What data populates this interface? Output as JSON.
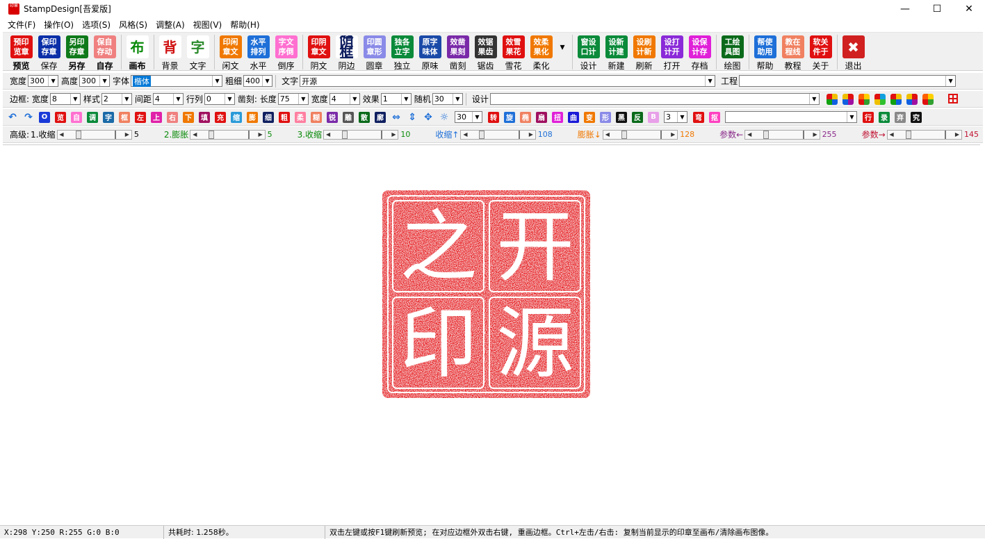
{
  "title": {
    "app_icon": "印章",
    "text": "StampDesign[吾爱版]",
    "min": "—",
    "max": "☐",
    "close": "✕"
  },
  "menu": [
    "文件(F)",
    "操作(O)",
    "选项(S)",
    "风格(S)",
    "调整(A)",
    "视图(V)",
    "帮助(H)"
  ],
  "toolbar": [
    {
      "icon": "预印\n览章",
      "label": "预览",
      "color": "#e01010",
      "bold": true
    },
    {
      "icon": "保印\n存章",
      "label": "保存",
      "color": "#0b2fa8"
    },
    {
      "icon": "另印\n存章",
      "label": "另存",
      "color": "#0f7a1a",
      "bold": true
    },
    {
      "icon": "保自\n存动",
      "label": "自存",
      "color": "#f08080",
      "bold": true
    },
    {
      "sep": true
    },
    {
      "icon": "布",
      "label": "画布",
      "color": "#ffffff",
      "text": "#0a8a0a",
      "bold": true
    },
    {
      "sep": true
    },
    {
      "icon": "背",
      "label": "背景",
      "color": "#ffffff",
      "text": "#d01010"
    },
    {
      "icon": "字",
      "label": "文字",
      "color": "#ffffff",
      "text": "#2a8a2a"
    },
    {
      "sep": true
    },
    {
      "icon": "印闲\n章文",
      "label": "闲文",
      "color": "#f07800"
    },
    {
      "icon": "水平\n排列",
      "label": "水平",
      "color": "#1e6fd8"
    },
    {
      "icon": "字文\n序倒",
      "label": "倒序",
      "color": "#ff6fd0"
    },
    {
      "sep": true
    },
    {
      "icon": "印阴\n章文",
      "label": "阴文",
      "color": "#e01010"
    },
    {
      "icon": "边阴\n框文",
      "label": "阴边",
      "color": "#ffffff",
      "text": "#102060"
    },
    {
      "icon": "印圆\n章形",
      "label": "圆章",
      "color": "#8a8ae8"
    },
    {
      "icon": "独各\n立字",
      "label": "独立",
      "color": "#0a8a3a"
    },
    {
      "icon": "原字\n味体",
      "label": "原味",
      "color": "#1a4aa8"
    },
    {
      "icon": "效凿\n果刻",
      "label": "凿刻",
      "color": "#7a2aa8"
    },
    {
      "icon": "效锯\n果齿",
      "label": "锯齿",
      "color": "#333333"
    },
    {
      "icon": "效雪\n果花",
      "label": "雪花",
      "color": "#e01010"
    },
    {
      "icon": "效柔\n果化",
      "label": "柔化",
      "color": "#f07800"
    },
    {
      "icon": "▾",
      "label": "",
      "color": "#f0f0f0",
      "text": "#000"
    },
    {
      "sep": true
    },
    {
      "icon": "窗设\n口计",
      "label": "设计",
      "color": "#0a8a3a"
    },
    {
      "icon": "设新\n计建",
      "label": "新建",
      "color": "#0a8a3a"
    },
    {
      "icon": "设刷\n计新",
      "label": "刷新",
      "color": "#f07800"
    },
    {
      "icon": "设打\n计开",
      "label": "打开",
      "color": "#8a2ad8"
    },
    {
      "icon": "设保\n计存",
      "label": "存档",
      "color": "#e020d8"
    },
    {
      "sep": true
    },
    {
      "icon": "工绘\n具图",
      "label": "绘图",
      "color": "#0a6a1a"
    },
    {
      "sep": true
    },
    {
      "icon": "帮使\n助用",
      "label": "帮助",
      "color": "#1e6fd8"
    },
    {
      "icon": "教在\n程线",
      "label": "教程",
      "color": "#f08060"
    },
    {
      "icon": "软关\n件于",
      "label": "关于",
      "color": "#e01010"
    },
    {
      "sep": true
    },
    {
      "icon": "✖",
      "label": "退出",
      "color": "#d02020"
    }
  ],
  "row1": {
    "width_label": "宽度",
    "width": "300",
    "height_label": "高度",
    "height": "300",
    "font_label": "字体",
    "font": "楷体",
    "weight_label": "粗细",
    "weight": "400",
    "text_label": "文字",
    "text": "开源",
    "project_label": "工程",
    "project": ""
  },
  "row2": {
    "border_label": "边框: 宽度",
    "border_width": "8",
    "style_label": "样式",
    "style": "2",
    "spacing_label": "间距",
    "spacing": "4",
    "line_label": "行列",
    "line": "0",
    "chisel_label": "凿刻: 长度",
    "chisel_len": "75",
    "chisel_width_label": "宽度",
    "chisel_width": "4",
    "effect_label": "效果",
    "effect": "1",
    "random_label": "随机",
    "random": "30",
    "design_label": "设计",
    "design": ""
  },
  "row3": {
    "buttons": [
      {
        "t": "O",
        "c": "#1a3ad8"
      },
      {
        "t": "览",
        "c": "#e01010"
      },
      {
        "t": "自",
        "c": "#ff6fd0"
      },
      {
        "t": "调",
        "c": "#0a8a3a"
      },
      {
        "t": "字",
        "c": "#1a6aa8"
      },
      {
        "t": "框",
        "c": "#f08060"
      },
      {
        "t": "左",
        "c": "#e01010"
      },
      {
        "t": "上",
        "c": "#e020a8"
      },
      {
        "t": "右",
        "c": "#f08080"
      },
      {
        "t": "下",
        "c": "#f07800"
      },
      {
        "t": "填",
        "c": "#a01060"
      },
      {
        "t": "充",
        "c": "#e01010"
      },
      {
        "t": "缩",
        "c": "#2a9ad8"
      },
      {
        "t": "膨",
        "c": "#f07800"
      },
      {
        "t": "细",
        "c": "#102060"
      },
      {
        "t": "粗",
        "c": "#e01010"
      },
      {
        "t": "柔",
        "c": "#ff7fa0"
      },
      {
        "t": "糊",
        "c": "#f08060"
      },
      {
        "t": "锐",
        "c": "#7a2aa8"
      },
      {
        "t": "雕",
        "c": "#555555"
      },
      {
        "t": "散",
        "c": "#0a6a1a"
      },
      {
        "t": "廓",
        "c": "#102060"
      }
    ],
    "select1": "30",
    "buttons2": [
      {
        "t": "转",
        "c": "#e01010"
      },
      {
        "t": "旋",
        "c": "#1e6fd8"
      },
      {
        "t": "椭",
        "c": "#f08060"
      },
      {
        "t": "扇",
        "c": "#a01060"
      },
      {
        "t": "扭",
        "c": "#e020d8"
      },
      {
        "t": "曲",
        "c": "#1a1ad8"
      },
      {
        "t": "变",
        "c": "#f07800"
      },
      {
        "t": "形",
        "c": "#8a8ae8"
      },
      {
        "t": "黑",
        "c": "#111111"
      },
      {
        "t": "反",
        "c": "#0a6a1a"
      },
      {
        "t": "B",
        "c": "#e8a0e8"
      }
    ],
    "select2": "3",
    "buttons3": [
      {
        "t": "弯",
        "c": "#e01010"
      },
      {
        "t": "抠",
        "c": "#ff40c0"
      }
    ],
    "big_select": "",
    "buttons4": [
      {
        "t": "行",
        "c": "#e01010"
      },
      {
        "t": "录",
        "c": "#0a8a3a"
      },
      {
        "t": "弃",
        "c": "#888888"
      },
      {
        "t": "究",
        "c": "#111111"
      }
    ]
  },
  "row4": {
    "label": "高级: ",
    "sliders": [
      {
        "label": "1.收缩",
        "value": "5",
        "color": "#000000"
      },
      {
        "label": "2.膨胀",
        "value": "5",
        "color": "#0a8a0a"
      },
      {
        "label": "3.收缩",
        "value": "10",
        "color": "#0a8a0a"
      },
      {
        "label": "收缩↑",
        "value": "108",
        "color": "#1e6fd8"
      },
      {
        "label": "膨胀↓",
        "value": "128",
        "color": "#f07800"
      },
      {
        "label": "参数←",
        "value": "255",
        "color": "#8a2a8a"
      },
      {
        "label": "参数→",
        "value": "145",
        "color": "#c01030"
      }
    ]
  },
  "stamp": {
    "chars": [
      "开",
      "之",
      "源",
      "印"
    ],
    "color": "#e8141a"
  },
  "status": {
    "coords": "X:298 Y:250 R:255 G:0 B:0",
    "time": "共耗时: 1.258秒。",
    "hint": "双击左键或按F1键刷新预览; 在对应边框外双击右键, 重画边框。Ctrl+左击/右击: 复制当前显示的印章至画布/清除画布图像。"
  }
}
